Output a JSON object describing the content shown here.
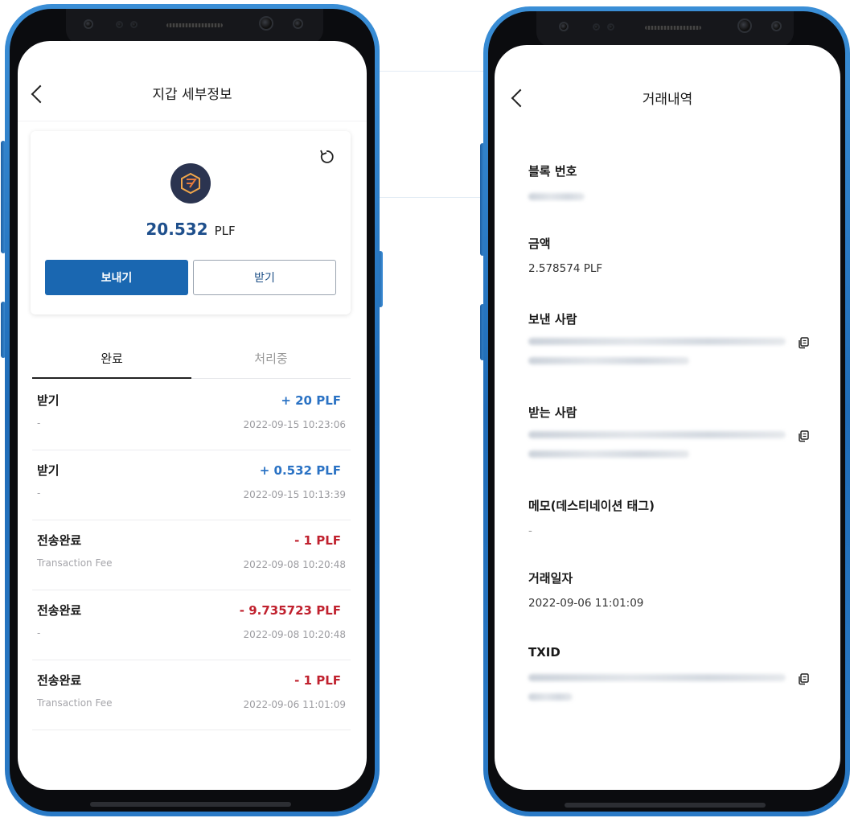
{
  "left_screen": {
    "header_title": "지갑 세부정보",
    "balance_value": "20.532",
    "balance_unit": "PLF",
    "send_label": "보내기",
    "receive_label": "받기",
    "tabs": [
      {
        "label": "완료",
        "active": true
      },
      {
        "label": "처리중",
        "active": false
      }
    ],
    "transactions": [
      {
        "title": "받기",
        "sub": "-",
        "amount": "+ 20 PLF",
        "direction": "in",
        "date": "2022-09-15 10:23:06"
      },
      {
        "title": "받기",
        "sub": "-",
        "amount": "+ 0.532 PLF",
        "direction": "in",
        "date": "2022-09-15 10:13:39"
      },
      {
        "title": "전송완료",
        "sub": "Transaction Fee",
        "amount": "- 1 PLF",
        "direction": "out",
        "date": "2022-09-08 10:20:48"
      },
      {
        "title": "전송완료",
        "sub": "-",
        "amount": "- 9.735723 PLF",
        "direction": "out",
        "date": "2022-09-08 10:20:48"
      },
      {
        "title": "전송완료",
        "sub": "Transaction Fee",
        "amount": "- 1 PLF",
        "direction": "out",
        "date": "2022-09-06 11:01:09"
      }
    ]
  },
  "right_screen": {
    "header_title": "거래내역",
    "fields": {
      "block_number": {
        "label": "블록 번호"
      },
      "amount": {
        "label": "금액",
        "value": "2.578574 PLF"
      },
      "sender": {
        "label": "보낸 사람"
      },
      "receiver": {
        "label": "받는 사람"
      },
      "memo": {
        "label": "메모(데스티네이션 태그)",
        "value": "-"
      },
      "date": {
        "label": "거래일자",
        "value": "2022-09-06 11:01:09"
      },
      "txid": {
        "label": "TXID"
      }
    }
  },
  "colors": {
    "primary": "#1a67b1",
    "incoming": "#2a72c4",
    "outgoing": "#c0212e",
    "phone_frame": "#2a7ac6"
  },
  "icons": [
    "back-arrow-icon",
    "refresh-icon",
    "coin-logo-icon",
    "copy-icon"
  ]
}
